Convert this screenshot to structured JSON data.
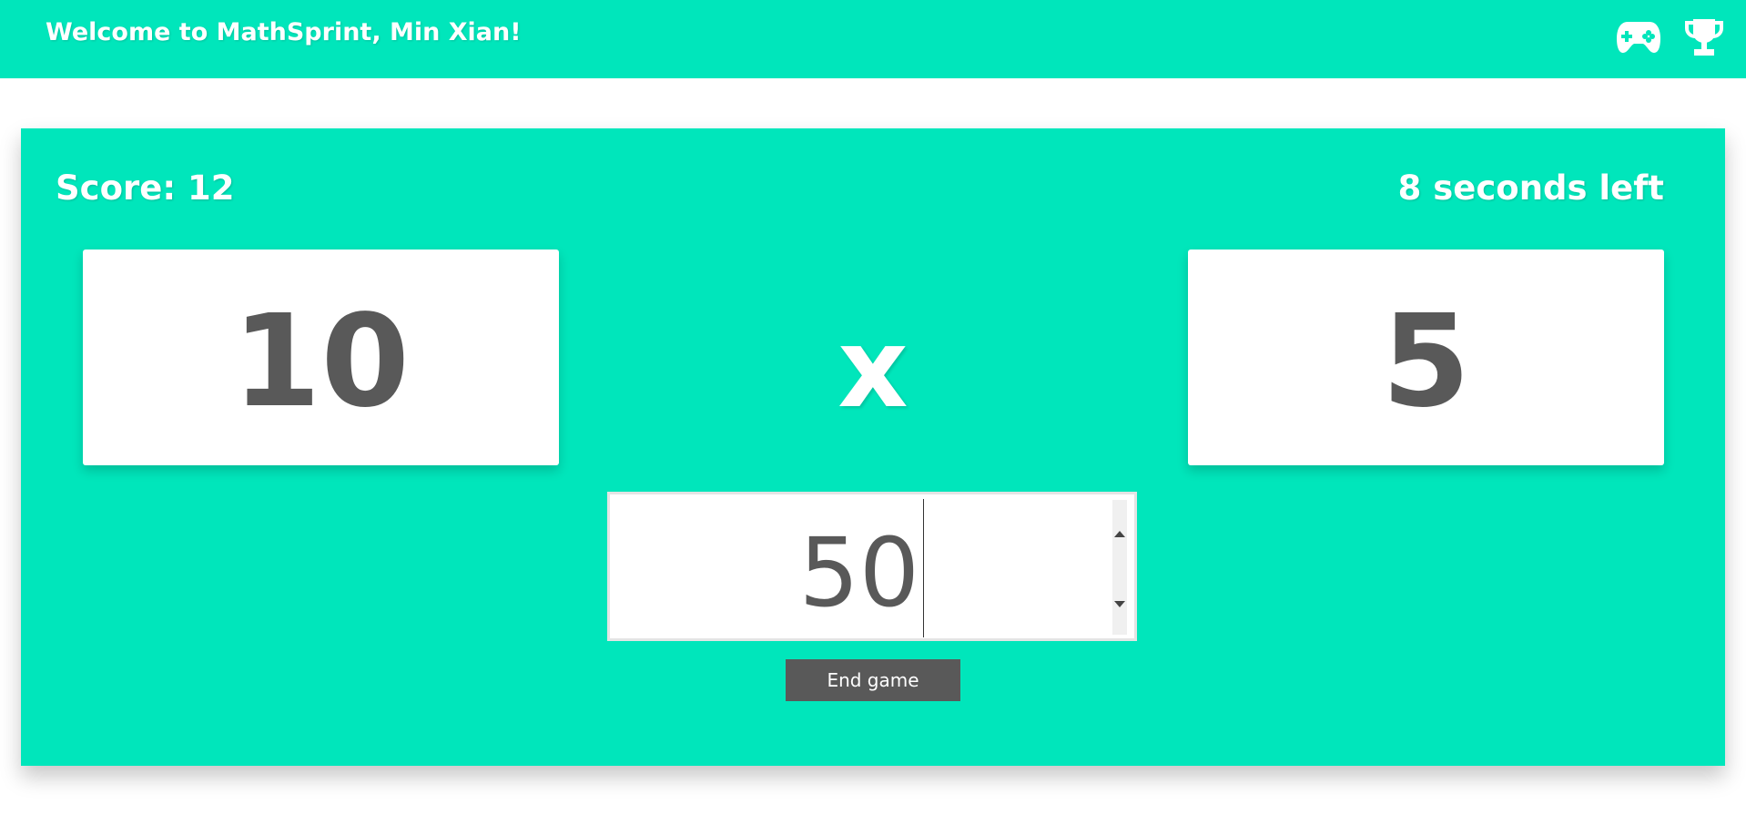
{
  "header": {
    "welcome_text": "Welcome to MathSprint, Min Xian!",
    "icons": [
      "game-controller-icon",
      "trophy-icon"
    ]
  },
  "game": {
    "score_text": "Score: 12",
    "timer_text": "8 seconds left",
    "operand_left": "10",
    "operator": "x",
    "operand_right": "5",
    "answer_value": "50",
    "end_button_label": "End game"
  },
  "colors": {
    "accent": "#00e6bb",
    "text_dark": "#595959",
    "white": "#ffffff"
  }
}
